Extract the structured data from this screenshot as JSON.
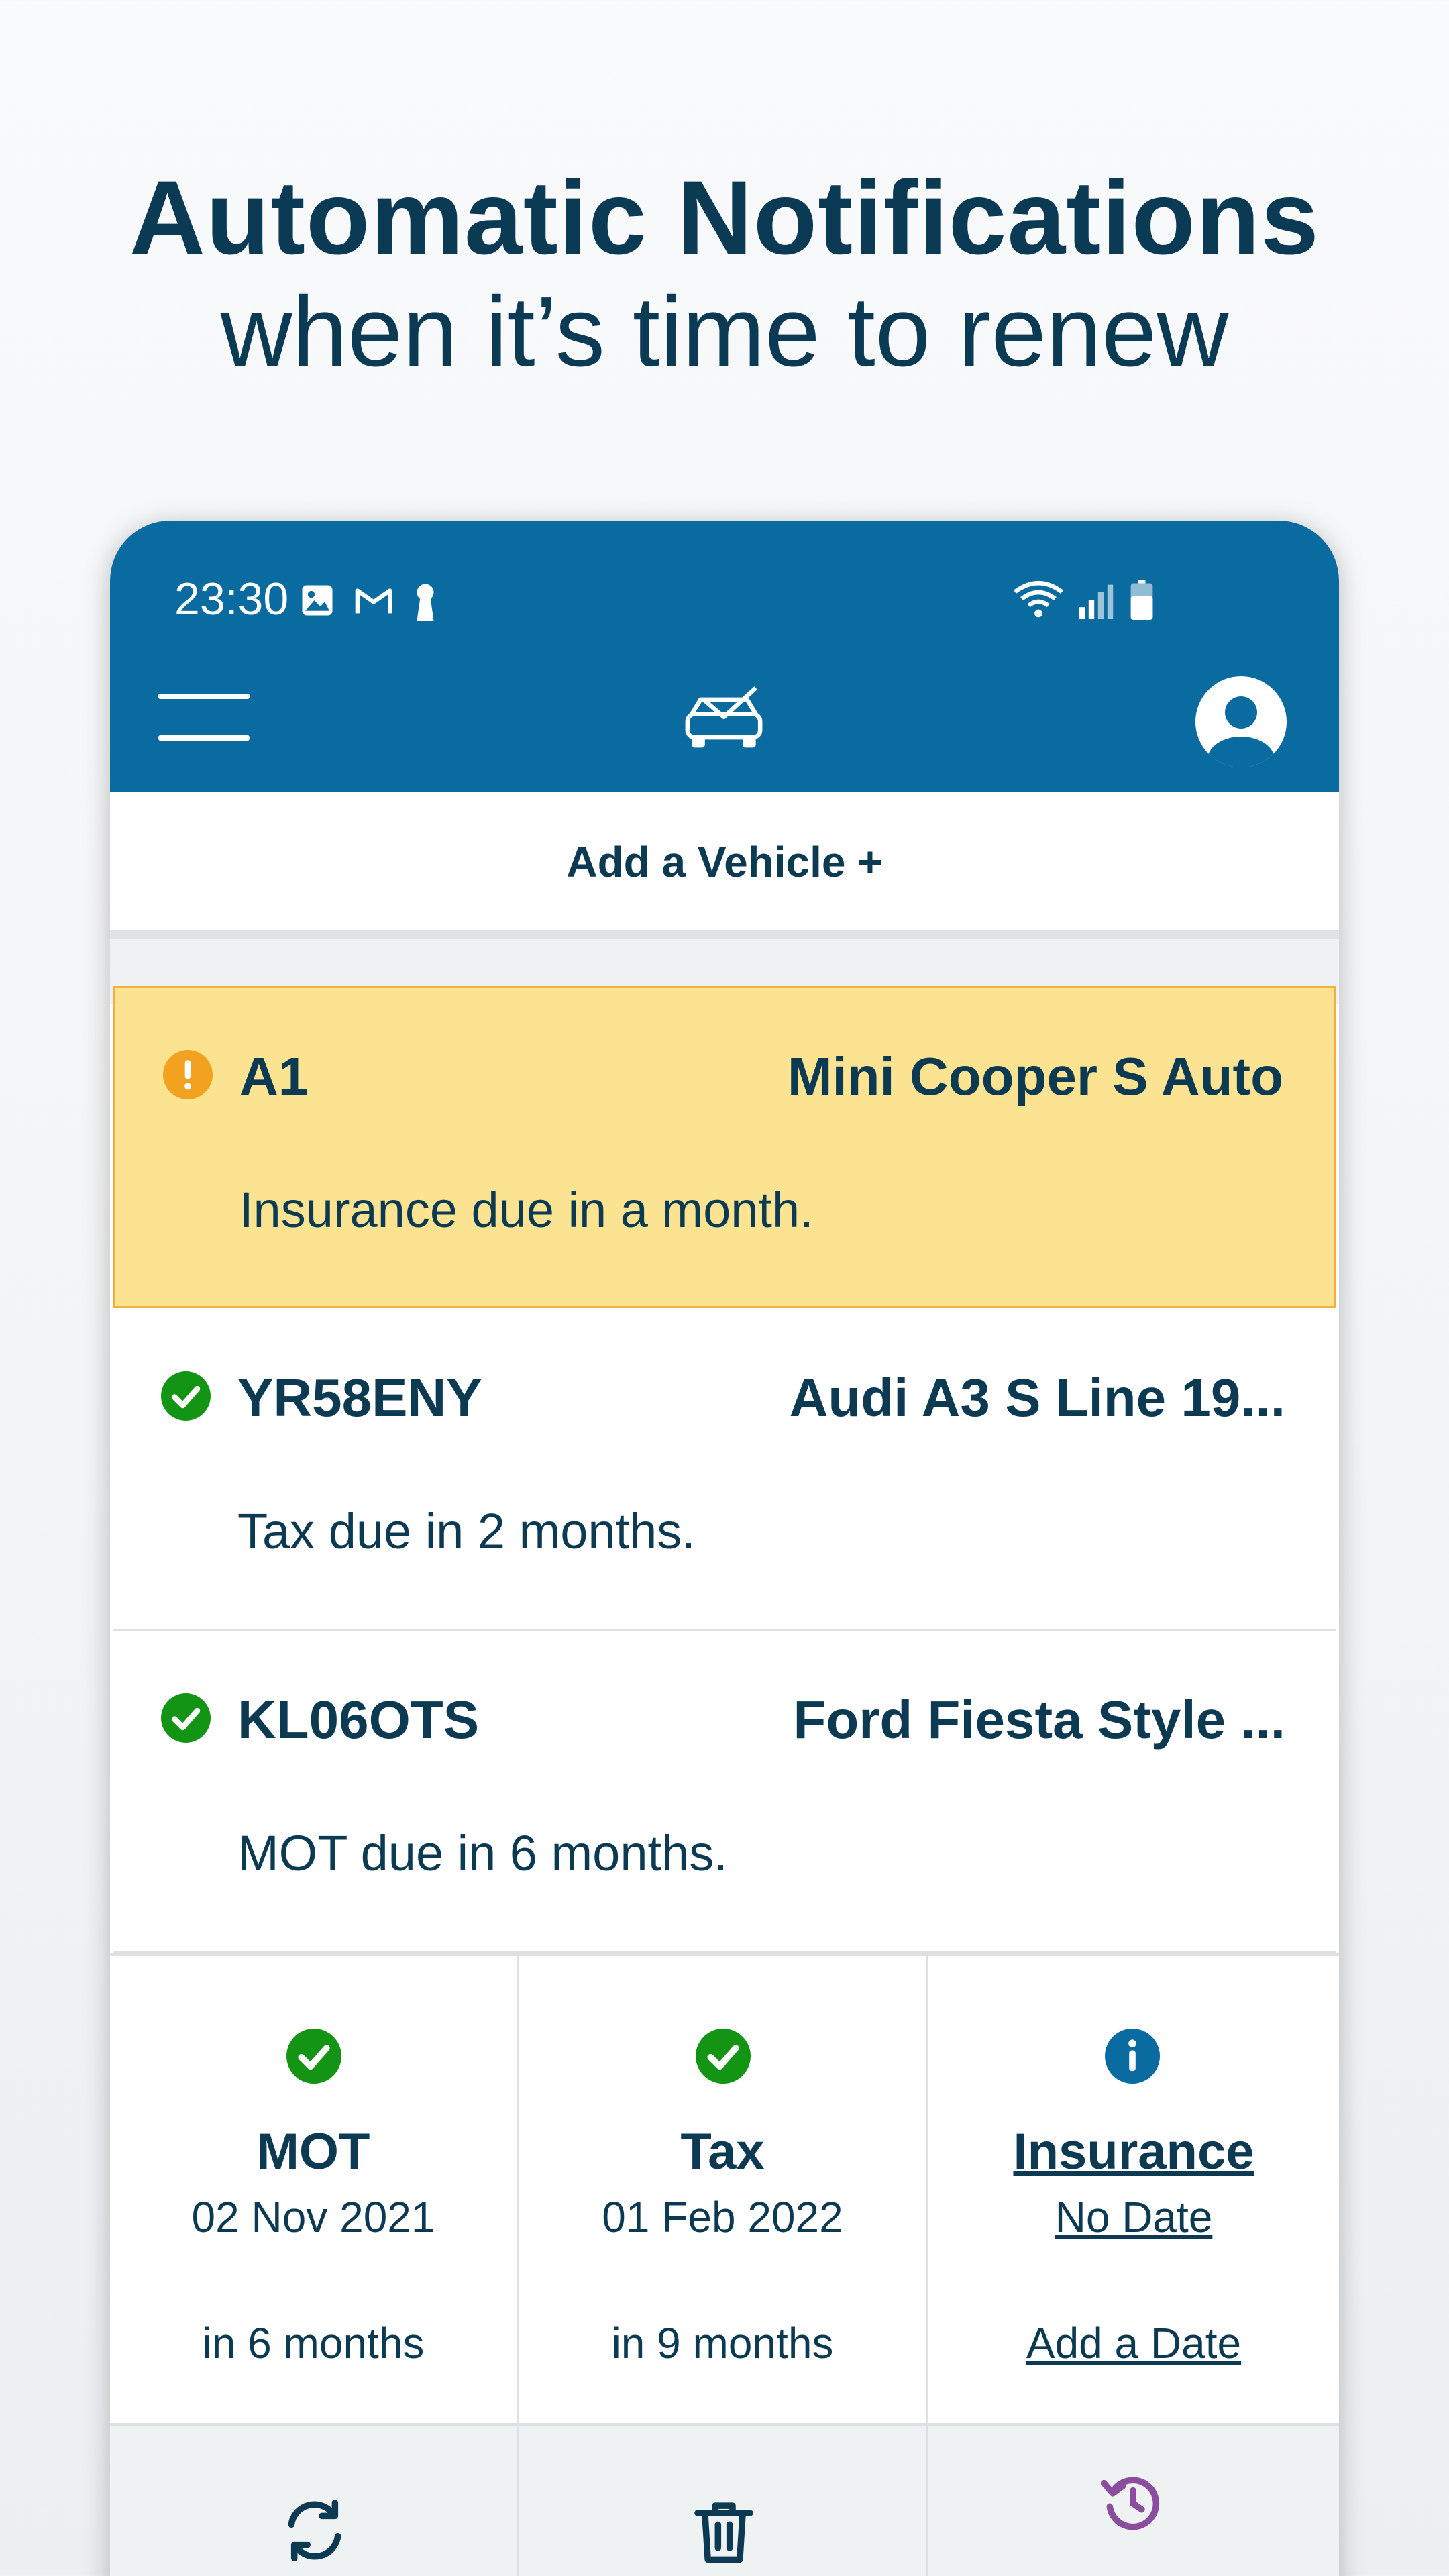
{
  "headline": {
    "line1": "Automatic Notifications",
    "line2": "when it’s time to renew"
  },
  "status_bar": {
    "time": "23:30",
    "left_icons": [
      "image-icon",
      "gmail-icon",
      "keyhole-icon"
    ],
    "right_icons": [
      "wifi-icon",
      "signal-icon",
      "battery-icon"
    ]
  },
  "app_bar": {
    "menu_icon": "hamburger-menu-icon",
    "logo_icon": "car-envelope-logo-icon",
    "account_icon": "account-icon"
  },
  "add_vehicle": {
    "label": "Add a Vehicle +"
  },
  "vehicles": [
    {
      "plate": "A1",
      "model": "Mini Cooper S Auto",
      "message": "Insurance due in a month.",
      "status": "warning",
      "icon": "warning-icon"
    },
    {
      "plate": "YR58ENY",
      "model": "Audi A3 S Line 19...",
      "message": "Tax due in 2 months.",
      "status": "ok",
      "icon": "check-icon"
    },
    {
      "plate": "KL06OTS",
      "model": "Ford Fiesta Style ...",
      "message": "MOT due in 6 months.",
      "status": "ok",
      "icon": "check-icon"
    }
  ],
  "details": [
    {
      "title": "MOT",
      "date": "02 Nov 2021",
      "relative": "in 6 months",
      "icon": "check-icon"
    },
    {
      "title": "Tax",
      "date": "01 Feb 2022",
      "relative": "in 9 months",
      "icon": "check-icon"
    },
    {
      "title": "Insurance",
      "date": "No Date",
      "relative": "Add a Date",
      "icon": "info-icon"
    }
  ],
  "actions": [
    {
      "icon": "refresh-icon"
    },
    {
      "icon": "trash-icon"
    },
    {
      "icon": "history-icon"
    }
  ],
  "colors": {
    "brand": "#0a6ba0",
    "text_dark": "#0c3a52",
    "warning_bg": "#fce391",
    "warning_icon": "#f2a21e",
    "ok_green": "#149414",
    "history_purple": "#8b4d9e"
  }
}
